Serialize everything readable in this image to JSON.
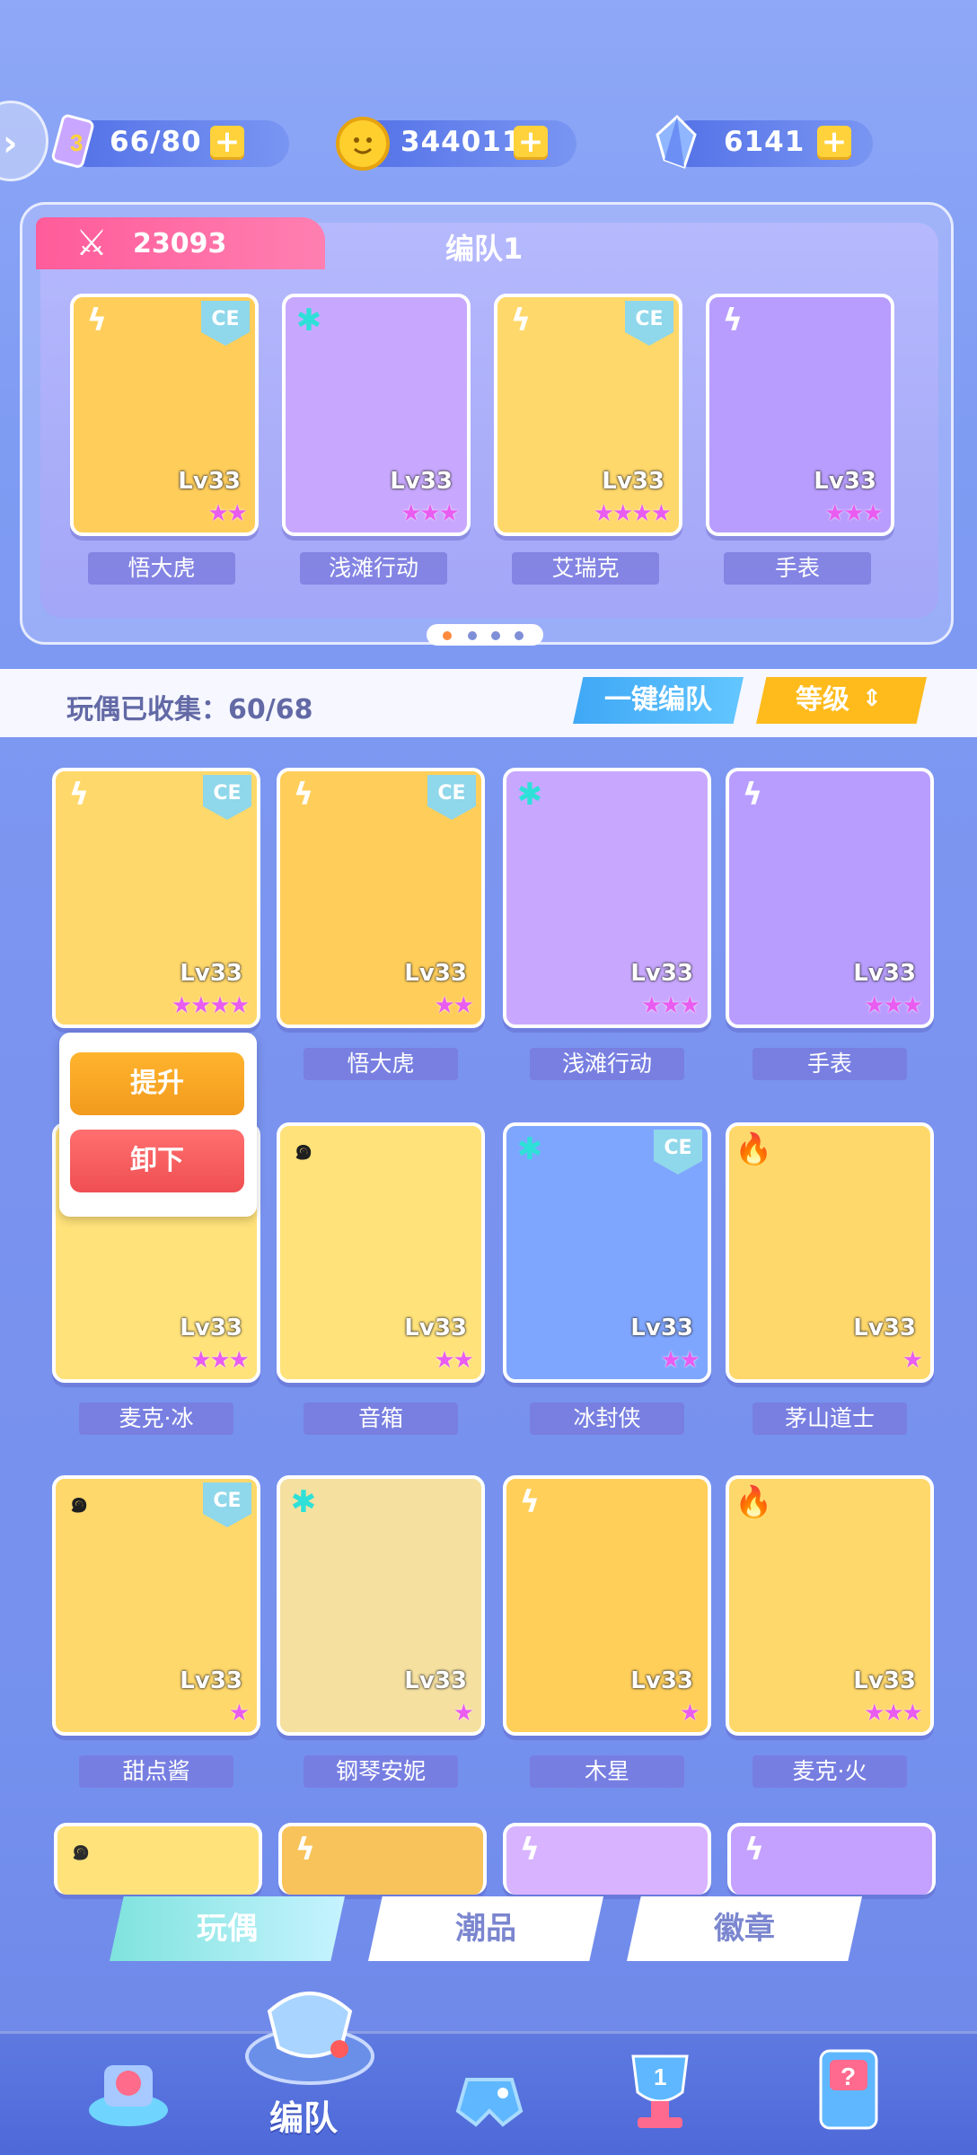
{
  "resources": {
    "stamina": {
      "value": "66/80",
      "icon": "stamina-card-icon"
    },
    "coins": {
      "value": "344011",
      "icon": "coin-icon"
    },
    "gems": {
      "value": "6141",
      "icon": "crystal-icon"
    },
    "plus": "+"
  },
  "team": {
    "power": "23093",
    "title": "编队1",
    "members": [
      {
        "name": "悟大虎",
        "level": "Lv33",
        "stars": "★★",
        "element": "lightning",
        "ce": "CE"
      },
      {
        "name": "浅滩行动",
        "level": "Lv33",
        "stars": "★★★",
        "element": "ice",
        "ce": ""
      },
      {
        "name": "艾瑞克",
        "level": "Lv33",
        "stars": "★★★★",
        "element": "lightning",
        "ce": "CE"
      },
      {
        "name": "手表",
        "level": "Lv33",
        "stars": "★★★",
        "element": "lightning",
        "ce": ""
      }
    ]
  },
  "collection": {
    "label": "玩偶已收集：60/68",
    "auto_team": "一键编队",
    "sort": "等级",
    "sort_icon": "⇕"
  },
  "popup": {
    "upgrade": "提升",
    "remove": "卸下"
  },
  "dolls": [
    {
      "name": "",
      "level": "Lv33",
      "stars": "★★★★",
      "element": "lightning",
      "ce": "CE"
    },
    {
      "name": "悟大虎",
      "level": "Lv33",
      "stars": "★★",
      "element": "lightning",
      "ce": "CE"
    },
    {
      "name": "浅滩行动",
      "level": "Lv33",
      "stars": "★★★",
      "element": "ice",
      "ce": ""
    },
    {
      "name": "手表",
      "level": "Lv33",
      "stars": "★★★",
      "element": "lightning",
      "ce": ""
    },
    {
      "name": "麦克·冰",
      "level": "Lv33",
      "stars": "★★★",
      "element": "ice",
      "ce": ""
    },
    {
      "name": "音箱",
      "level": "Lv33",
      "stars": "★★",
      "element": "wind",
      "ce": ""
    },
    {
      "name": "冰封侠",
      "level": "Lv33",
      "stars": "★★",
      "element": "ice",
      "ce": "CE"
    },
    {
      "name": "茅山道士",
      "level": "Lv33",
      "stars": "★",
      "element": "fire",
      "ce": ""
    },
    {
      "name": "甜点酱",
      "level": "Lv33",
      "stars": "★",
      "element": "wind",
      "ce": "CE"
    },
    {
      "name": "钢琴安妮",
      "level": "Lv33",
      "stars": "★",
      "element": "ice",
      "ce": ""
    },
    {
      "name": "木星",
      "level": "Lv33",
      "stars": "★",
      "element": "lightning",
      "ce": ""
    },
    {
      "name": "麦克·火",
      "level": "Lv33",
      "stars": "★★★",
      "element": "fire",
      "ce": ""
    }
  ],
  "tabs": [
    "玩偶",
    "潮品",
    "徽章"
  ],
  "nav": {
    "active_label": "编队"
  },
  "colors": {
    "power": "#ff6aa2",
    "auto_team": "#4fb6f8",
    "sort": "#ffbb1c",
    "upgrade": "#f7a21f",
    "remove": "#f25a5a"
  }
}
